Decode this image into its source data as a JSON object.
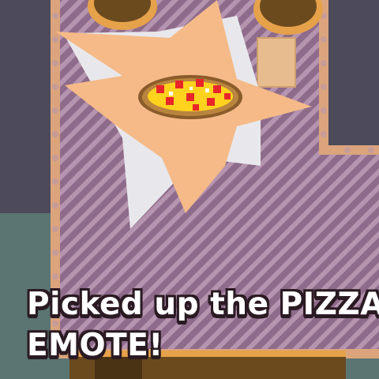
{
  "notification": {
    "line1": "Picked up the PIZZA",
    "line2": "EMOTE!"
  },
  "colors": {
    "background": "#4d4a5c",
    "floor_teal": "#5a7572",
    "rug_base": "#8e6b8a",
    "rug_stripe": "#b594b0",
    "rug_border": "#dca47c",
    "paper_star": "#f5ba88",
    "paper_white": "#e8e8ec",
    "pizza_crust": "#b9843e",
    "pizza_cheese": "#ffd31d",
    "pepperoni": "#e8262a",
    "table_top": "#6b4a1e",
    "table_edge": "#e6a24a"
  },
  "emote_item": {
    "icon": "pizza-icon",
    "name": "PIZZA"
  }
}
